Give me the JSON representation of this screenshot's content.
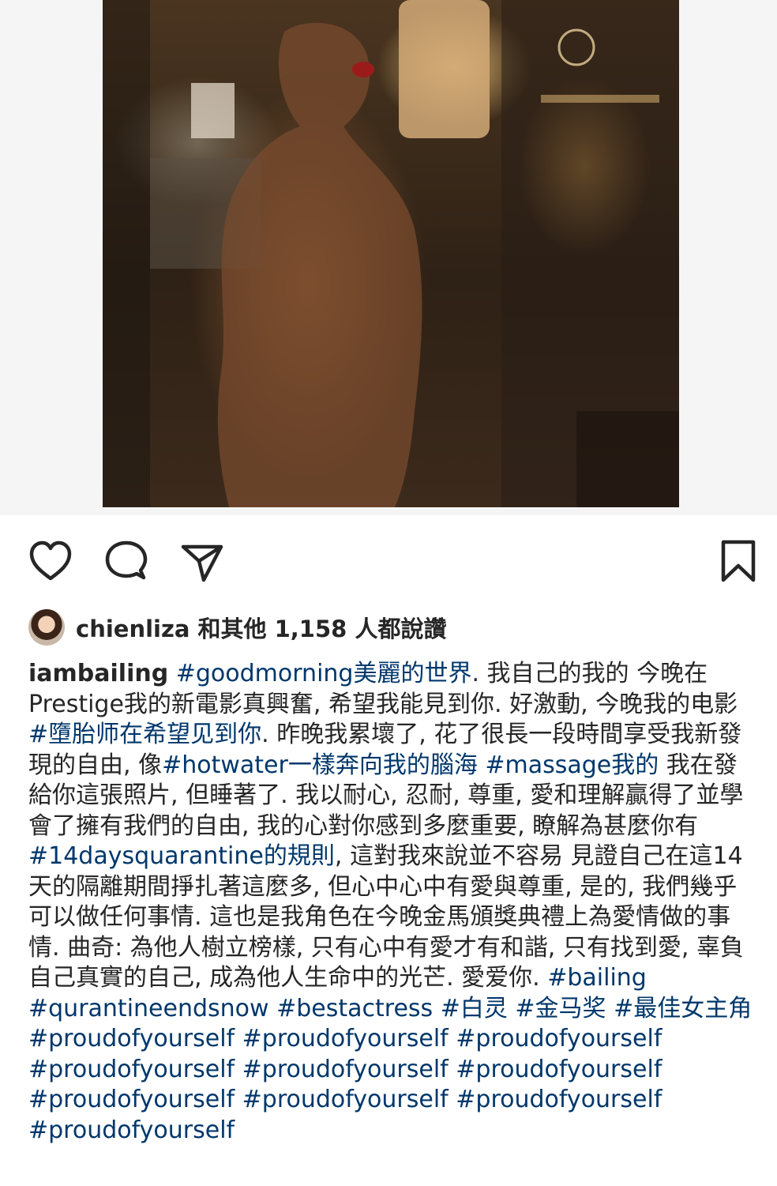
{
  "post": {
    "username": "iambailing"
  },
  "likes": {
    "liker": "chienliza",
    "rest": " 和其他 1,158 人都說讚"
  },
  "caption": [
    {
      "type": "tag",
      "text": "#goodmorning美麗的世界"
    },
    {
      "type": "text",
      "text": ". 我自己的我的 今晚在Prestige我的新電影真興奮, 希望我能見到你. 好激動, 今晚我的电影"
    },
    {
      "type": "tag",
      "text": "#墮胎师在希望见到你"
    },
    {
      "type": "text",
      "text": ". 昨晚我累壞了, 花了很長一段時間享受我新發現的自由, 像"
    },
    {
      "type": "tag",
      "text": "#hotwater一樣奔向我的腦海"
    },
    {
      "type": "text",
      "text": " "
    },
    {
      "type": "tag",
      "text": "#massage我的"
    },
    {
      "type": "text",
      "text": " 我在發給你這張照片, 但睡著了. 我以耐心, 忍耐, 尊重, 愛和理解贏得了並學會了擁有我們的自由, 我的心對你感到多麼重要, 瞭解為甚麼你有"
    },
    {
      "type": "tag",
      "text": "#14daysquarantine的規則"
    },
    {
      "type": "text",
      "text": ", 這對我來說並不容易 見證自己在這14天的隔離期間掙扎著這麼多, 但心中心中有愛與尊重, 是的, 我們幾乎可以做任何事情. 這也是我角色在今晚金馬頒獎典禮上為愛情做的事情. 曲奇: 為他人樹立榜樣, 只有心中有愛才有和諧, 只有找到愛, 辜負自己真實的自己, 成為他人生命中的光芒. 愛爱你. "
    },
    {
      "type": "tag",
      "text": "#bailing"
    },
    {
      "type": "text",
      "text": " "
    },
    {
      "type": "tag",
      "text": "#qurantineendsnow"
    },
    {
      "type": "text",
      "text": " "
    },
    {
      "type": "tag",
      "text": "#bestactress"
    },
    {
      "type": "text",
      "text": " "
    },
    {
      "type": "tag",
      "text": "#白灵"
    },
    {
      "type": "text",
      "text": " "
    },
    {
      "type": "tag",
      "text": "#金马奖"
    },
    {
      "type": "text",
      "text": " "
    },
    {
      "type": "tag",
      "text": "#最佳女主角"
    },
    {
      "type": "text",
      "text": " "
    },
    {
      "type": "tag",
      "text": "#proudofyourself"
    },
    {
      "type": "text",
      "text": " "
    },
    {
      "type": "tag",
      "text": "#proudofyourself"
    },
    {
      "type": "text",
      "text": " "
    },
    {
      "type": "tag",
      "text": "#proudofyourself"
    },
    {
      "type": "text",
      "text": " "
    },
    {
      "type": "tag",
      "text": "#proudofyourself"
    },
    {
      "type": "text",
      "text": " "
    },
    {
      "type": "tag",
      "text": "#proudofyourself"
    },
    {
      "type": "text",
      "text": " "
    },
    {
      "type": "tag",
      "text": "#proudofyourself"
    },
    {
      "type": "text",
      "text": " "
    },
    {
      "type": "tag",
      "text": "#proudofyourself"
    },
    {
      "type": "text",
      "text": " "
    },
    {
      "type": "tag",
      "text": "#proudofyourself"
    },
    {
      "type": "text",
      "text": " "
    },
    {
      "type": "tag",
      "text": "#proudofyourself"
    },
    {
      "type": "text",
      "text": " "
    },
    {
      "type": "tag",
      "text": "#proudofyourself"
    }
  ],
  "icons": {
    "like": "heart-icon",
    "comment": "comment-icon",
    "share": "paper-plane-icon",
    "save": "bookmark-icon",
    "tagged": "user-tag-icon"
  },
  "colors": {
    "text": "#262626",
    "hashtag": "#00376b",
    "background": "#ffffff"
  }
}
